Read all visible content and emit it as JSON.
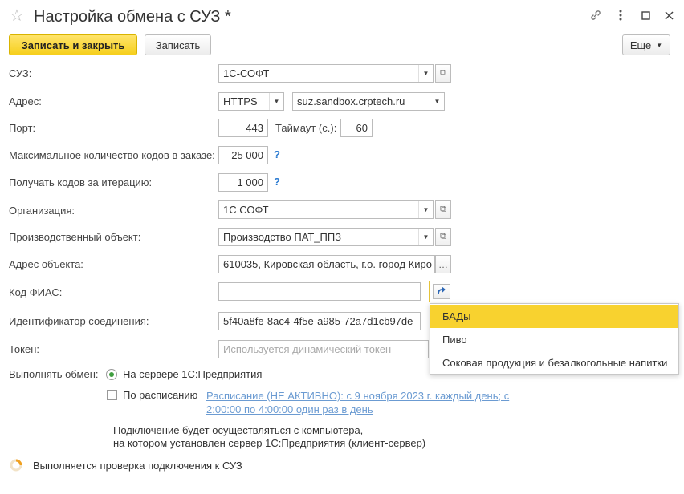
{
  "window": {
    "title": "Настройка обмена с СУЗ *"
  },
  "toolbar": {
    "save_close": "Записать и закрыть",
    "save": "Записать",
    "more": "Еще"
  },
  "form": {
    "suz": {
      "label": "СУЗ:",
      "value": "1С-СОФТ"
    },
    "address": {
      "label": "Адрес:",
      "protocol": "HTTPS",
      "host": "suz.sandbox.crptech.ru"
    },
    "port": {
      "label": "Порт:",
      "value": "443",
      "timeout_label": "Таймаут (с.):",
      "timeout_value": "60"
    },
    "max_codes": {
      "label": "Максимальное количество кодов в заказе:",
      "value": "25 000",
      "help": "?"
    },
    "codes_per_iter": {
      "label": "Получать кодов за итерацию:",
      "value": "1 000",
      "help": "?"
    },
    "organization": {
      "label": "Организация:",
      "value": "1С СОФТ"
    },
    "production_object": {
      "label": "Производственный объект:",
      "value": "Производство ПАТ_ППЗ"
    },
    "object_address": {
      "label": "Адрес объекта:",
      "value": "610035, Кировская область, г.о. город Киро"
    },
    "fias": {
      "label": "Код ФИАС:",
      "value": ""
    },
    "connection_id": {
      "label": "Идентификатор соединения:",
      "value": "5f40a8fe-8ac4-4f5e-a985-72a7d1cb97de"
    },
    "token": {
      "label": "Токен:",
      "placeholder": "Используется динамический токен"
    },
    "exchange": {
      "label": "Выполнять обмен:",
      "option_server": "На сервере 1С:Предприятия",
      "option_schedule": "По расписанию",
      "schedule_link_line1": "Расписание (НЕ АКТИВНО): с 9 ноября 2023 г. каждый день; с",
      "schedule_link_line2": "2:00:00 по 4:00:00 один раз в день",
      "note_line1": "Подключение будет осуществляться с компьютера,",
      "note_line2": "на котором установлен сервер 1С:Предприятия (клиент-сервер)"
    }
  },
  "popup": {
    "items": [
      "БАДы",
      "Пиво",
      "Соковая продукция и безалкогольные напитки"
    ],
    "selected_index": 0
  },
  "status": {
    "text": "Выполняется проверка подключения к СУЗ"
  },
  "colors": {
    "accent_yellow": "#f6cf1c",
    "link_blue": "#6b9bd2",
    "help_blue": "#2a7ad1"
  }
}
